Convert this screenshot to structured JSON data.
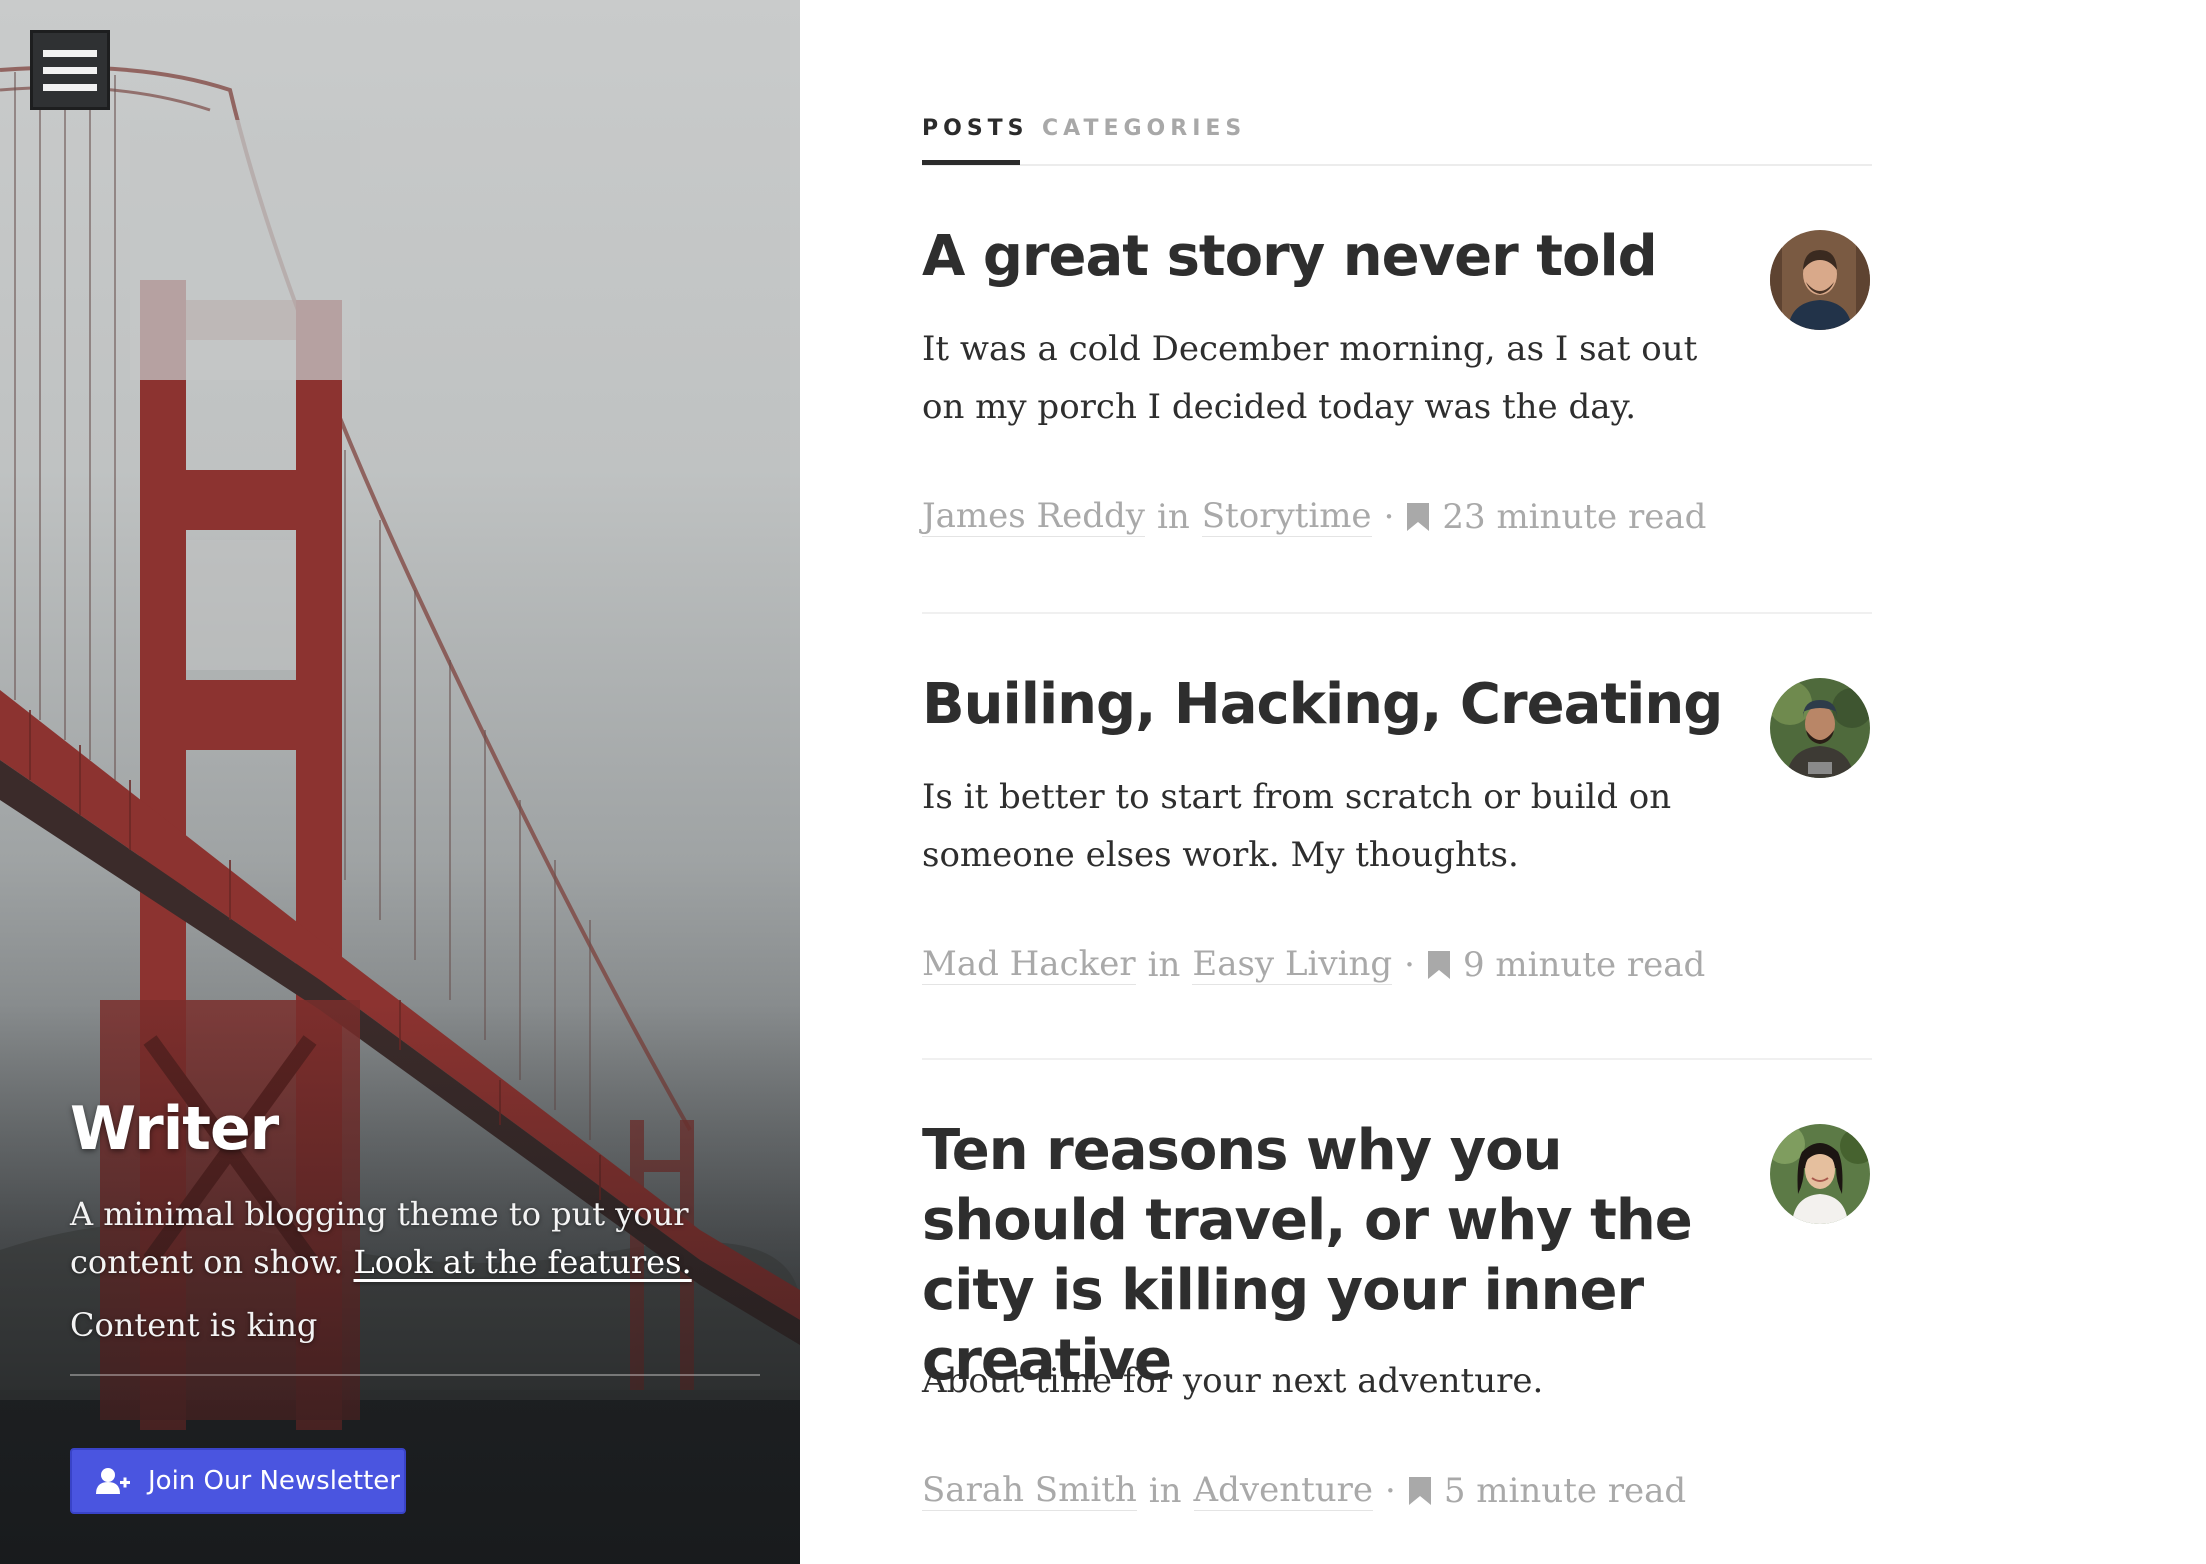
{
  "hero": {
    "menu_icon": "hamburger-icon",
    "site_title": "Writer",
    "description": "A minimal blogging theme to put your content on show.",
    "features_link": "Look at the features.",
    "tagline": "Content is king",
    "newsletter_button": "Join Our Newsletter",
    "newsletter_icon": "user-plus-icon",
    "accent_color": "#4a55e0"
  },
  "tabs": {
    "posts": "POSTS",
    "categories": "CATEGORIES",
    "active": "POSTS"
  },
  "posts": [
    {
      "title": "A great story never told",
      "excerpt": "It was a cold December morning, as I sat out on my porch I decided today was the day.",
      "author": "James Reddy",
      "in": "in",
      "category": "Storytime",
      "separator": "·",
      "read_icon": "bookmark-icon",
      "read_time": "23 minute read"
    },
    {
      "title": "Builing, Hacking, Creating",
      "excerpt": "Is it better to start from scratch or build on someone elses work. My thoughts.",
      "author": "Mad Hacker",
      "in": "in",
      "category": "Easy Living",
      "separator": "·",
      "read_icon": "bookmark-icon",
      "read_time": "9 minute read"
    },
    {
      "title": "Ten reasons why you should travel, or why the city is killing your inner creative",
      "excerpt": "About time for your next adventure.",
      "author": "Sarah Smith",
      "in": "in",
      "category": "Adventure",
      "separator": "·",
      "read_icon": "bookmark-icon",
      "read_time": "5 minute read"
    }
  ]
}
